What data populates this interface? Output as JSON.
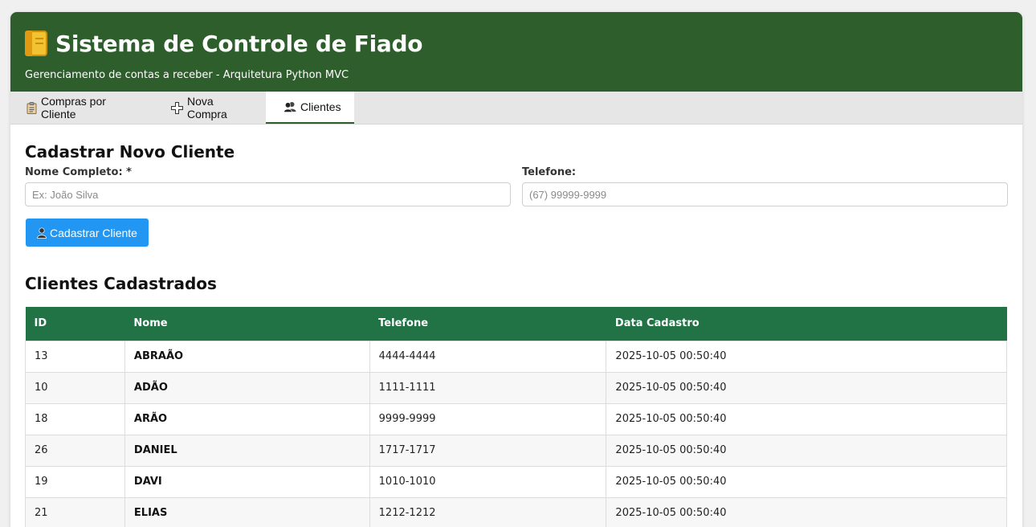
{
  "header": {
    "title": "Sistema de Controle de Fiado",
    "subtitle": "Gerenciamento de contas a receber - Arquitetura Python MVC",
    "icon": "notebook-icon",
    "color": "#2d5e2b"
  },
  "tabs": [
    {
      "label": "Compras por Cliente",
      "icon": "clipboard-icon"
    },
    {
      "label": "Nova Compra",
      "icon": "plus-icon"
    },
    {
      "label": "Clientes",
      "icon": "users-icon",
      "active": true
    }
  ],
  "form": {
    "title": "Cadastrar Novo Cliente",
    "nome_label": "Nome Completo: *",
    "nome_placeholder": "Ex: João Silva",
    "telefone_label": "Telefone:",
    "telefone_placeholder": "(67) 99999-9999",
    "submit_label": "Cadastrar Cliente",
    "submit_color": "#2196f3"
  },
  "list": {
    "title": "Clientes Cadastrados",
    "columns": [
      "ID",
      "Nome",
      "Telefone",
      "Data Cadastro"
    ],
    "header_color": "#217346",
    "rows": [
      {
        "id": "13",
        "nome": "ABRAÃO",
        "telefone": "4444-4444",
        "data": "2025-10-05 00:50:40"
      },
      {
        "id": "10",
        "nome": "ADÃO",
        "telefone": "1111-1111",
        "data": "2025-10-05 00:50:40"
      },
      {
        "id": "18",
        "nome": "ARÃO",
        "telefone": "9999-9999",
        "data": "2025-10-05 00:50:40"
      },
      {
        "id": "26",
        "nome": "DANIEL",
        "telefone": "1717-1717",
        "data": "2025-10-05 00:50:40"
      },
      {
        "id": "19",
        "nome": "DAVI",
        "telefone": "1010-1010",
        "data": "2025-10-05 00:50:40"
      },
      {
        "id": "21",
        "nome": "ELIAS",
        "telefone": "1212-1212",
        "data": "2025-10-05 00:50:40"
      }
    ]
  }
}
